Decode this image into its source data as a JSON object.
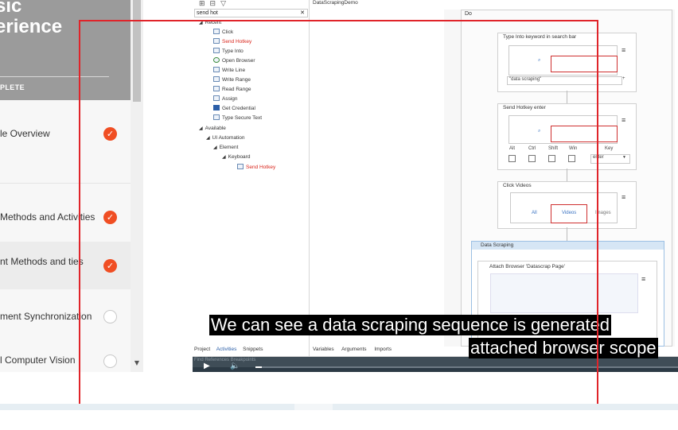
{
  "sidebar": {
    "title_lines": [
      "sic",
      "erience"
    ],
    "status": "PLETE",
    "lessons": [
      {
        "label": "le Overview",
        "complete": true
      },
      {
        "label": "Methods and Activities",
        "complete": true
      },
      {
        "label": "nt Methods and ties",
        "complete": true
      },
      {
        "label": "ment Synchronization",
        "complete": false
      },
      {
        "label": "l Computer Vision",
        "complete": false
      }
    ],
    "scroll_down_icon": "triangle-down-icon"
  },
  "studio": {
    "document_tab": "DataScrapingDemo",
    "search": {
      "value": "send hot",
      "clear_icon": "close-icon"
    },
    "tree": {
      "recent_label": "Recent",
      "recent_items": [
        "Click",
        "Send Hotkey",
        "Type Into",
        "Open Browser",
        "Write Line",
        "Write Range",
        "Read Range",
        "Assign",
        "Get Credential",
        "Type Secure Text"
      ],
      "available_label": "Available",
      "ui_automation": "UI Automation",
      "element": "Element",
      "keyboard": "Keyboard",
      "result": "Send Hotkey"
    },
    "panel_tabs": [
      "Project",
      "Activities",
      "Snippets"
    ],
    "designer_tabs": [
      "Variables",
      "Arguments",
      "Imports"
    ],
    "refs_text": "Find References    Breakpoints",
    "workflow": {
      "do_label": "Do",
      "type_into": {
        "title": "Type Into keyword in search bar",
        "text": "\"data scraping\""
      },
      "send_hotkey": {
        "title": "Send Hotkey enter",
        "modifiers": [
          "Alt",
          "Ctrl",
          "Shift",
          "Win"
        ],
        "key_label": "Key",
        "key_value": "enter"
      },
      "click": {
        "title": "Click Videos",
        "tabs": [
          "All",
          "Videos",
          "Images"
        ]
      },
      "data_scraping": {
        "title": "Data Scraping",
        "attach": "Attach Browser 'Datascrap Page'"
      }
    }
  },
  "player": {
    "play_icon": "play-icon",
    "volume_icon": "volume-icon",
    "progress": 0.015
  },
  "captions": [
    "We can see a data scraping sequence is generated",
    "attached browser scope"
  ],
  "colors": {
    "accent": "#f04e23",
    "highlight": "#e0242a",
    "selection": "#d9261c"
  }
}
